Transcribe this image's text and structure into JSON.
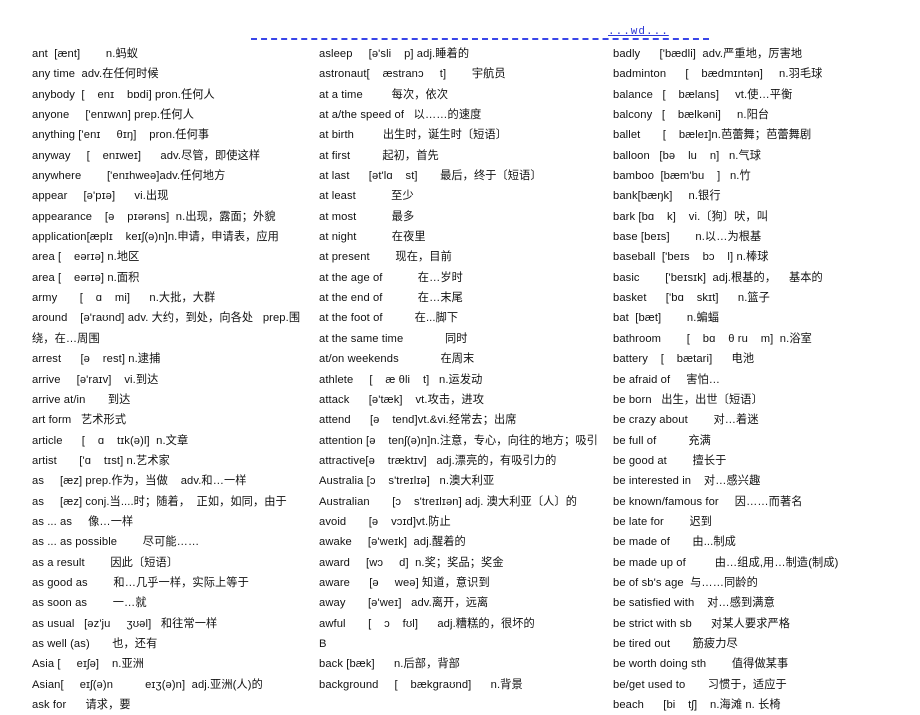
{
  "header": {
    "link_text": "...wd...",
    "rule_color": "#3a46e8",
    "link_color": "#2b35d6"
  },
  "columns": {
    "left": [
      "ant  [ænt]        n.蚂蚁",
      "any time  adv.在任何时候",
      "anybody  [    enɪ    bɒdi] pron.任何人",
      "anyone     ['enɪwʌn] prep.任何人",
      "anything ['enɪ     θɪŋ]    pron.任何事",
      "anyway     [    enɪweɪ]      adv.尽管，即使这样",
      "anywhere        ['enɪhweə]adv.任何地方",
      "appear     [ə'pɪə]      vi.出现",
      "appearance    [ə    pɪərəns]  n.出现，露面；外貌",
      "application[æplɪ    keɪʃ(ə)n]n.申请，申请表，应用",
      "area [    eərɪə] n.地区",
      "area [    eərɪə] n.面积",
      "army       [    ɑ    mi]      n.大批，大群",
      "around    [ə'raʊnd] adv. 大约，到处，向各处   prep.围绕，在…周围",
      "arrest      [ə    rest] n.逮捕",
      "arrive     [ə'raɪv]    vi.到达",
      "arrive at/in       到达",
      "art form   艺术形式",
      "article      [    ɑ    tɪk(ə)l]  n.文章",
      "artist       ['ɑ    tɪst] n.艺术家",
      "as     [æz] prep.作为，当做    adv.和…一样",
      "as     [æz] conj.当....时；随着，  正如，如同，由于",
      "as ... as     像…一样",
      "as ... as possible        尽可能……",
      "as a result        因此〔短语〕",
      "as good as        和…几乎一样，实际上等于",
      "as soon as        一…就",
      "as usual   [əz'ju     ʒʊəl]   和往常一样",
      "as well (as)       也，还有",
      "Asia [     eɪʃə]    n.亚洲",
      "Asian[     eɪʃ(ə)n          eɪʒ(ə)n]  adj.亚洲(人)的",
      "ask for      请求，要"
    ],
    "middle": [
      "asleep     [ə'sli    p] adj.睡着的",
      "astronaut[    æstranɔ     t]        宇航员",
      "at a time         每次，依次",
      "at a/the speed of   以……的速度",
      "at birth         出生时，诞生时〔短语〕",
      "at first          起初，首先",
      "at last      [ət'lɑ    st]       最后，终于〔短语〕",
      "at least           至少",
      "at most           最多",
      "at night           在夜里",
      "at present        现在，目前",
      "at the age of           在…岁时",
      "at the end of           在…末尾",
      "at the foot of          在...脚下",
      "at the same time             同时",
      "at/on weekends             在周末",
      "athlete     [    æ θli    t]   n.运发动",
      "attack      [ə'tæk]    vt.攻击，进攻",
      "attend      [ə    tend]vt.&vi.经常去；出席",
      "attention [ə    tenʃ(ə)n]n.注意，专心，向往的地方；吸引",
      "attractive[ə    træktɪv]   adj.漂亮的，有吸引力的",
      "Australia [ɔ    s'treɪlɪə]   n.澳大利亚",
      "Australian       [ɔ    s'treɪlɪən] adj. 澳大利亚〔人〕的",
      "avoid       [ə    vɔɪd]vt.防止",
      "awake     [ə'weɪk]  adj.醒着的",
      "award     [wɔ     d]  n.奖；奖品；奖金",
      "aware      [ə     weə] 知道，意识到",
      "away       [ə'weɪ]   adv.离开，远离",
      "awful       [    ɔ    fʊl]      adj.糟糕的，很坏的",
      "B",
      "back [bæk]      n.后部，背部",
      "background     [    bækgraʊnd]      n.背景"
    ],
    "right": [
      "badly      ['bædli]  adv.严重地，厉害地",
      "badminton      [    bædmɪntən]     n.羽毛球",
      "balance   [    bælans]     vt.使…平衡",
      "balcony   [    bælkəni]     n.阳台",
      "ballet       [    bæleɪ]n.芭蕾舞；芭蕾舞剧",
      "balloon   [bə    lu    n]   n.气球",
      "bamboo  [bæm'bu    ]   n.竹",
      "bank[bæŋk]     n.银行",
      "bark [bɑ    k]    vi.〔狗〕吠，叫",
      "base [beɪs]        n.以…为根基",
      "baseball  ['beɪs    bɔ    l] n.棒球",
      "basic        ['beɪsɪk]  adj.根基的，    基本的",
      "basket      ['bɑ    skɪt]      n.篮子",
      "bat  [bæt]        n.蝙蝠",
      "bathroom        [    bɑ    θ ru    m]  n.浴室",
      "battery    [    bætari]      电池",
      "be afraid of     害怕…",
      "be born   出生，出世〔短语〕",
      "be crazy about        对…着迷",
      "be full of          充满",
      "be good at        擅长于",
      "be interested in    对…感兴趣",
      "be known/famous for     因……而著名",
      "be late for        迟到",
      "be made of       由...制成",
      "be made up of         由…组成,用…制造(制成)",
      "be of sb's age  与……同龄的",
      "be satisfied with    对…感到满意",
      "be strict with sb      对某人要求严格",
      "be tired out       筋疲力尽",
      "be worth doing sth        值得做某事",
      "be/get used to       习惯于，适应于",
      "beach      [bi    tʃ]    n.海滩 n. 长椅"
    ]
  }
}
